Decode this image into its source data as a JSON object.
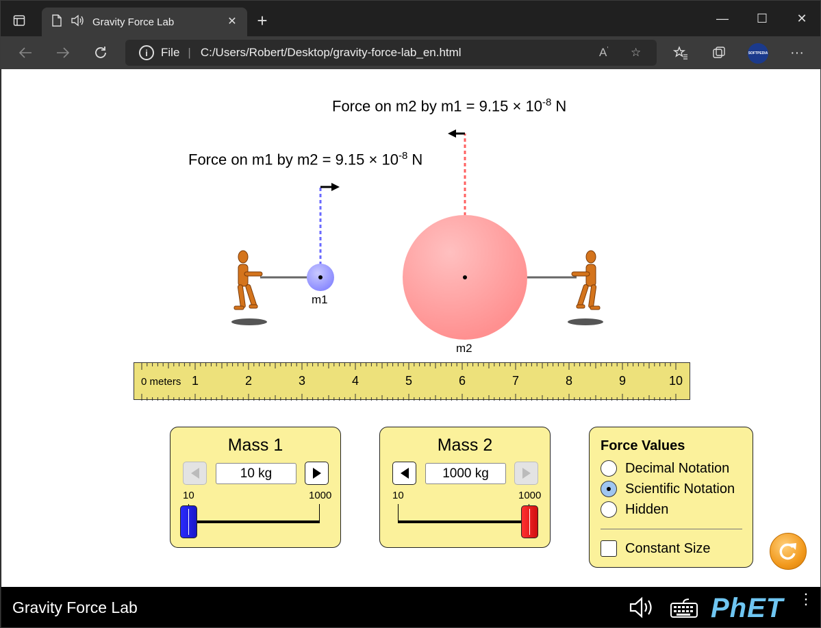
{
  "browser": {
    "tab_title": "Gravity Force Lab",
    "address_prefix": "File",
    "url": "C:/Users/Robert/Desktop/gravity-force-lab_en.html",
    "profile_label": "SOFTPEDIA"
  },
  "sim": {
    "force_m2": {
      "text": "Force on m2 by m1 = 9.15 × 10",
      "exp": "-8",
      "unit": " N"
    },
    "force_m1": {
      "text": "Force on m1 by m2 = 9.15 × 10",
      "exp": "-8",
      "unit": " N"
    },
    "m1_label": "m1",
    "m2_label": "m2",
    "ruler": {
      "unit_label": "0 meters",
      "ticks": [
        "1",
        "2",
        "3",
        "4",
        "5",
        "6",
        "7",
        "8",
        "9",
        "10"
      ]
    },
    "mass1": {
      "title": "Mass 1",
      "value": "10 kg",
      "min": "10",
      "max": "1000",
      "fraction": 0.0
    },
    "mass2": {
      "title": "Mass 2",
      "value": "1000 kg",
      "min": "10",
      "max": "1000",
      "fraction": 1.0
    },
    "force_values": {
      "title": "Force Values",
      "options": [
        "Decimal Notation",
        "Scientific Notation",
        "Hidden"
      ],
      "selected": "Scientific Notation",
      "checkbox": "Constant Size"
    }
  },
  "footer": {
    "title": "Gravity Force Lab",
    "logo": "PhET"
  }
}
